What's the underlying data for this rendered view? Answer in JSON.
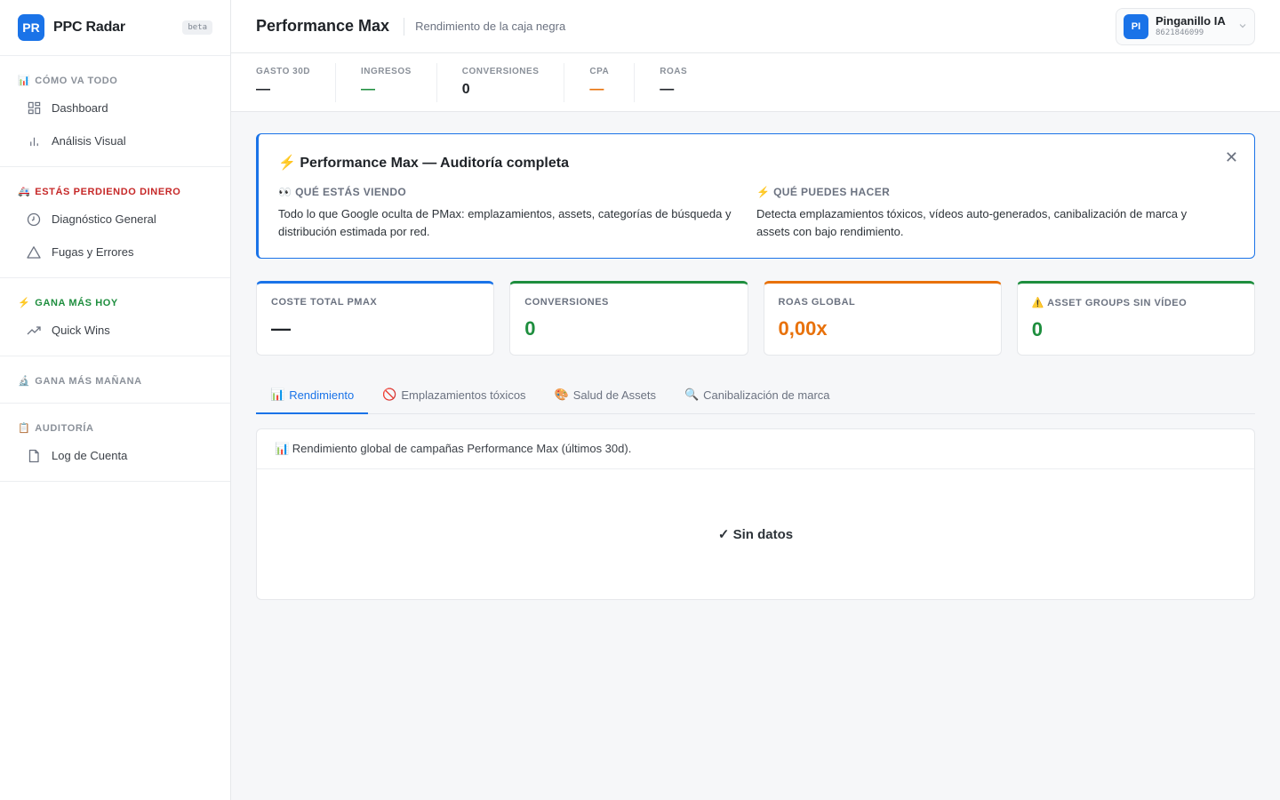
{
  "brand": {
    "initials": "PR",
    "name": "PPC Radar",
    "badge": "beta"
  },
  "sidebar": {
    "sections": [
      {
        "emoji": "📊",
        "title": "Cómo va todo",
        "items": [
          {
            "label": "Dashboard",
            "icon": "grid-icon"
          },
          {
            "label": "Análisis Visual",
            "icon": "bar-chart-icon"
          }
        ]
      },
      {
        "emoji": "🚑",
        "title": "Estás perdiendo dinero",
        "items": [
          {
            "label": "Diagnóstico General",
            "icon": "clock-icon"
          },
          {
            "label": "Fugas y Errores",
            "icon": "warning-triangle-icon"
          }
        ]
      },
      {
        "emoji": "⚡",
        "title": "Gana más hoy",
        "items": [
          {
            "label": "Quick Wins",
            "icon": "trending-up-icon"
          }
        ]
      },
      {
        "emoji": "🔬",
        "title": "Gana más mañana",
        "items": []
      },
      {
        "emoji": "📋",
        "title": "Auditoría",
        "items": [
          {
            "label": "Log de Cuenta",
            "icon": "document-icon"
          }
        ]
      }
    ]
  },
  "header": {
    "title": "Performance Max",
    "subtitle": "Rendimiento de la caja negra",
    "account": {
      "initials": "PI",
      "name": "Pinganillo IA",
      "id": "8621846099"
    }
  },
  "metrics": [
    {
      "label": "Gasto 30D",
      "value": "—",
      "color": "#1f2328"
    },
    {
      "label": "Ingresos",
      "value": "—",
      "color": "#1e8e3e"
    },
    {
      "label": "Conversiones",
      "value": "0",
      "color": "#1f2328"
    },
    {
      "label": "CPA",
      "value": "—",
      "color": "#e8710a"
    },
    {
      "label": "ROAS",
      "value": "—",
      "color": "#1f2328"
    }
  ],
  "info": {
    "title": "⚡ Performance Max — Auditoría completa",
    "close": "✕",
    "left_title": "👀 Qué estás viendo",
    "left_text": "Todo lo que Google oculta de PMax: emplazamientos, assets, categorías de búsqueda y distribución estimada por red.",
    "right_title": "⚡ Qué puedes hacer",
    "right_text": "Detecta emplazamientos tóxicos, vídeos auto-generados, canibalización de marca y assets con bajo rendimiento."
  },
  "kpis": [
    {
      "label": "Coste total PMAX",
      "value": "—",
      "accent": "#1a73e8"
    },
    {
      "label": "Conversiones",
      "value": "0",
      "accent": "#1e8e3e"
    },
    {
      "label": "ROAS Global",
      "value": "0,00x",
      "accent": "#e8710a"
    },
    {
      "label": "⚠️ Asset Groups sin vídeo",
      "value": "0",
      "accent": "#1e8e3e"
    }
  ],
  "tabs": [
    {
      "emoji": "📊",
      "label": "Rendimiento",
      "active": true
    },
    {
      "emoji": "🚫",
      "label": "Emplazamientos tóxicos",
      "active": false
    },
    {
      "emoji": "🎨",
      "label": "Salud de Assets",
      "active": false
    },
    {
      "emoji": "🔍",
      "label": "Canibalización de marca",
      "active": false
    }
  ],
  "panel": {
    "heading": "📊 Rendimiento global de campañas Performance Max (últimos 30d).",
    "empty": "✓ Sin datos"
  },
  "colors": {
    "accent": "#1a73e8",
    "success": "#1e8e3e",
    "warning": "#e8710a",
    "danger": "#c62828"
  }
}
